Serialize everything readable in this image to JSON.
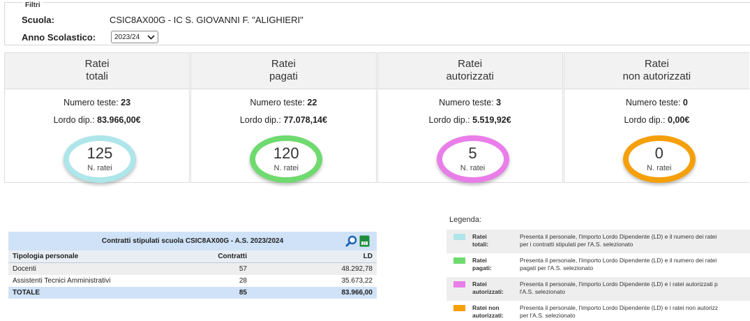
{
  "filters": {
    "legend": "Filtri",
    "scuola_label": "Scuola:",
    "scuola_value": "CSIC8AX00G - IC S. GIOVANNI F. \"ALIGHIERI\"",
    "anno_label": "Anno Scolastico:",
    "anno_value": "2023/24"
  },
  "cards": [
    {
      "title1": "Ratei",
      "title2": "totali",
      "teste_label": "Numero teste:",
      "teste": "23",
      "lordo_label": "Lordo dip.:",
      "lordo": "83.966,00€",
      "count": "125",
      "count_label": "N. ratei",
      "color": "#aee6ea"
    },
    {
      "title1": "Ratei",
      "title2": "pagati",
      "teste_label": "Numero teste:",
      "teste": "22",
      "lordo_label": "Lordo dip.:",
      "lordo": "77.078,14€",
      "count": "120",
      "count_label": "N. ratei",
      "color": "#6fda6f"
    },
    {
      "title1": "Ratei",
      "title2": "autorizzati",
      "teste_label": "Numero teste:",
      "teste": "3",
      "lordo_label": "Lordo dip.:",
      "lordo": "5.519,92€",
      "count": "5",
      "count_label": "N. ratei",
      "color": "#e97ee9"
    },
    {
      "title1": "Ratei",
      "title2": "non autorizzati",
      "teste_label": "Numero teste:",
      "teste": "0",
      "lordo_label": "Lordo dip.:",
      "lordo": "0,00€",
      "count": "0",
      "count_label": "N. ratei",
      "color": "#f5a00a"
    }
  ],
  "table": {
    "title": "Contratti stipulati scuola CSIC8AX00G - A.S. 2023/2024",
    "headers": [
      "Tipologia personale",
      "Contratti",
      "LD"
    ],
    "rows": [
      [
        "Docenti",
        "57",
        "48.292,78"
      ],
      [
        "Assistenti Tecnici Amministrativi",
        "28",
        "35.673,22"
      ]
    ],
    "total": [
      "TOTALE",
      "85",
      "83.966,00"
    ],
    "search_icon": "search-icon",
    "excel_icon": "excel-export-icon"
  },
  "legend": {
    "title": "Legenda:",
    "items": [
      {
        "name1": "Ratei",
        "name2": "totali:",
        "desc1": "Presenta il personale, l'importo Lordo Dipendente (LD) e il numero dei ratei",
        "desc2": "per i contratti stipulati per l'A.S. selezionato",
        "color": "#aee6ea"
      },
      {
        "name1": "Ratei",
        "name2": "pagati:",
        "desc1": "Presenta il personale, l'importo Lordo Dipendente (LD) e il numero dei ratei",
        "desc2": "pagati per l'A.S. selezionato",
        "color": "#6fda6f"
      },
      {
        "name1": "Ratei",
        "name2": "autorizzati:",
        "desc1": "Presenta il personale, l'importo Lordo Dipendente (LD) e i ratei autorizzati p",
        "desc2": "l'A.S. selezionato",
        "color": "#e97ee9"
      },
      {
        "name1": "Ratei non",
        "name2": "autorizzati:",
        "desc1": "Presenta il personale, l'importo Lordo Dipendente (LD) e i ratei non autorizz",
        "desc2": "per l'A.S. selezionato",
        "color": "#f5a00a"
      }
    ]
  }
}
